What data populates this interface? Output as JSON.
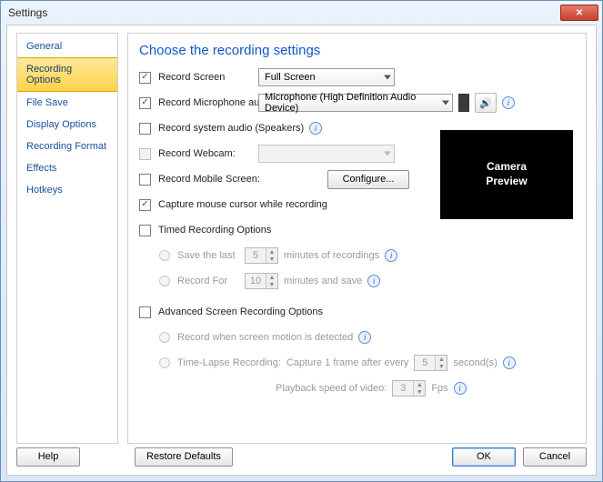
{
  "window": {
    "title": "Settings"
  },
  "sidebar": {
    "items": [
      {
        "label": "General"
      },
      {
        "label": "Recording Options"
      },
      {
        "label": "File Save"
      },
      {
        "label": "Display Options"
      },
      {
        "label": "Recording Format"
      },
      {
        "label": "Effects"
      },
      {
        "label": "Hotkeys"
      }
    ],
    "active_index": 1
  },
  "page": {
    "title": "Choose the recording settings",
    "record_screen": {
      "label": "Record Screen",
      "checked": true,
      "value": "Full Screen"
    },
    "record_mic": {
      "label": "Record Microphone audio",
      "checked": true,
      "value": "Microphone (High Definition Audio Device)"
    },
    "record_system_audio": {
      "label": "Record system audio (Speakers)",
      "checked": false
    },
    "record_webcam": {
      "label": "Record Webcam:",
      "checked": false,
      "value": ""
    },
    "record_mobile": {
      "label": "Record Mobile Screen:",
      "checked": false,
      "button": "Configure..."
    },
    "capture_cursor": {
      "label": "Capture mouse cursor while recording",
      "checked": true
    },
    "timed": {
      "label": "Timed Recording Options",
      "checked": false,
      "save_last": {
        "label": "Save the last",
        "value": "5",
        "suffix": "minutes of recordings"
      },
      "record_for": {
        "label": "Record For",
        "value": "10",
        "suffix": "minutes and save"
      }
    },
    "advanced": {
      "label": "Advanced Screen Recording Options",
      "checked": false,
      "motion": {
        "label": "Record when screen motion is detected"
      },
      "timelapse": {
        "label": "Time-Lapse Recording:",
        "capture_prefix": "Capture 1 frame after every",
        "capture_value": "5",
        "capture_suffix": "second(s)",
        "playback_prefix": "Playback speed of video:",
        "playback_value": "3",
        "playback_suffix": "Fps"
      }
    },
    "preview": "Camera\nPreview"
  },
  "footer": {
    "help": "Help",
    "restore": "Restore Defaults",
    "ok": "OK",
    "cancel": "Cancel"
  }
}
